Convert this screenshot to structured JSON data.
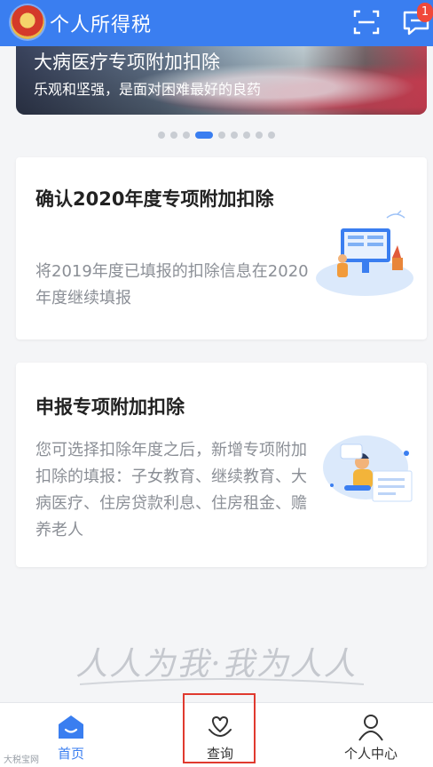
{
  "header": {
    "title": "个人所得税",
    "badge_count": "1",
    "icons": {
      "logo": "tax-emblem-icon",
      "scan": "scan-icon",
      "messages": "message-icon"
    }
  },
  "banner": {
    "title": "大病医疗专项附加扣除",
    "subtitle": "乐观和坚强，是面对困难最好的良药",
    "dot_count": 9,
    "active_index": 4
  },
  "cards": [
    {
      "title": "确认2020年度专项附加扣除",
      "description": "将2019年度已填报的扣除信息在2020年度继续填报",
      "illustration": "desk-computer-illustration"
    },
    {
      "title": "申报专项附加扣除",
      "description": "您可选择扣除年度之后，新增专项附加扣除的填报：子女教育、继续教育、大病医疗、住房贷款利息、住房租金、赡养老人",
      "illustration": "person-form-illustration"
    }
  ],
  "slogan": "人人为我·我为人人",
  "bottom_nav": {
    "items": [
      {
        "label": "首页",
        "icon": "home-icon",
        "active": true
      },
      {
        "label": "查询",
        "icon": "query-heart-icon",
        "active": false
      },
      {
        "label": "个人中心",
        "icon": "person-icon",
        "active": false
      }
    ]
  },
  "watermark": "大税宝网",
  "colors": {
    "primary": "#3a7ef0",
    "highlight": "#e03a2f",
    "badge": "#f0483a"
  }
}
